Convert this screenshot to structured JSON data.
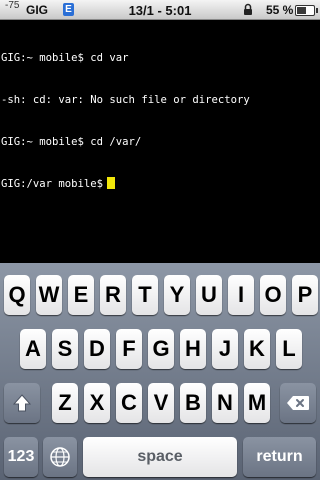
{
  "status_bar": {
    "signal": "-75",
    "carrier": "GIG",
    "network_badge": "E",
    "time": "13/1 - 5:01",
    "lock_icon": "lock-icon",
    "battery_percent": "55 %",
    "battery_level": 0.55
  },
  "terminal": {
    "lines": [
      "GIG:~ mobile$ cd var",
      "-sh: cd: var: No such file or directory",
      "GIG:~ mobile$ cd /var/",
      "GIG:/var mobile$"
    ],
    "cursor_color": "#f2e70a"
  },
  "keyboard": {
    "row1": [
      "Q",
      "W",
      "E",
      "R",
      "T",
      "Y",
      "U",
      "I",
      "O",
      "P"
    ],
    "row2": [
      "A",
      "S",
      "D",
      "F",
      "G",
      "H",
      "J",
      "K",
      "L"
    ],
    "row3": [
      "Z",
      "X",
      "C",
      "V",
      "B",
      "N",
      "M"
    ],
    "shift_icon": "shift-icon",
    "delete_icon": "delete-icon",
    "numbers_label": "123",
    "globe_icon": "globe-icon",
    "space_label": "space",
    "return_label": "return"
  }
}
